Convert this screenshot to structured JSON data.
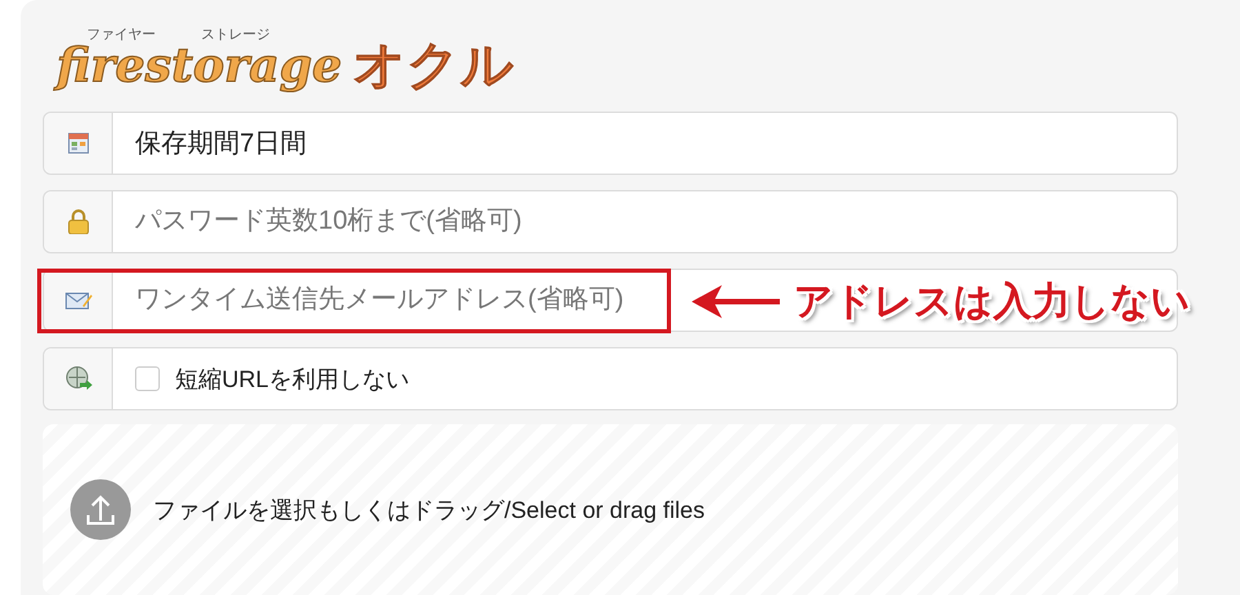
{
  "logo": {
    "main": "firestorage",
    "ruby_1": "ファイヤー",
    "ruby_2": "ストレージ",
    "sub": "オクル"
  },
  "fields": [
    {
      "kind": "select",
      "value": "保存期間7日間",
      "highlighted": false
    },
    {
      "kind": "input",
      "placeholder": "パスワード英数10桁まで(省略可)",
      "highlighted": false
    },
    {
      "kind": "input",
      "placeholder": "ワンタイム送信先メールアドレス(省略可)",
      "highlighted": true
    },
    {
      "kind": "checkbox",
      "label": "短縮URLを利用しない",
      "checked": false,
      "highlighted": false
    }
  ],
  "annotation": {
    "text": "アドレスは入力しない"
  },
  "upload": {
    "text": "ファイルを選択もしくはドラッグ/Select or drag files"
  }
}
